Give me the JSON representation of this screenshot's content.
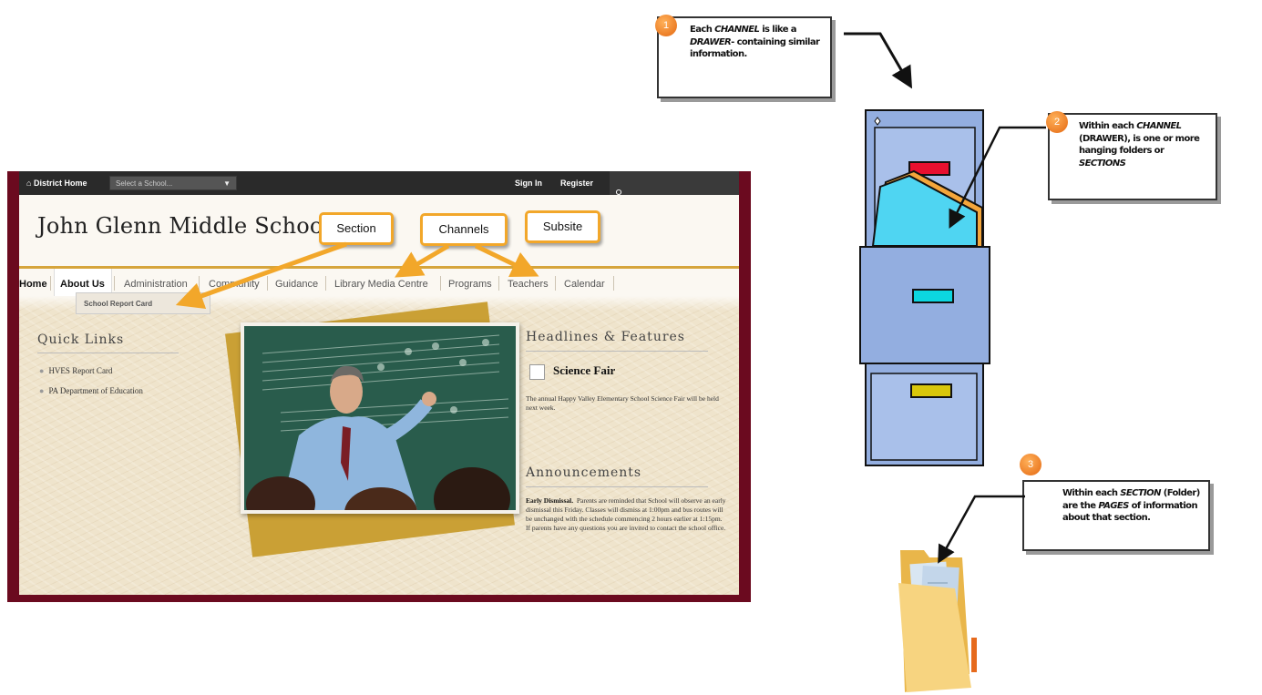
{
  "website": {
    "topbar": {
      "home": "District Home",
      "school_select": "Select a School...",
      "sign_in": "Sign In",
      "register": "Register"
    },
    "school_name": "John Glenn Middle School",
    "nav": [
      "Home",
      "About Us",
      "Administration",
      "Community",
      "Guidance",
      "Library Media Centre",
      "Programs",
      "Teachers",
      "Calendar"
    ],
    "dropdown_item": "School Report Card",
    "quick_links": {
      "title": "Quick Links",
      "items": [
        "HVES Report Card",
        "PA Department of Education"
      ]
    },
    "headlines": {
      "title": "Headlines & Features",
      "item_title": "Science Fair",
      "item_text": "The annual Happy Valley Elementary School Science Fair will be held next week."
    },
    "announcements": {
      "title": "Announcements",
      "lead": "Early Dismissal.",
      "text": "Parents are reminded that School will observe an early dismissal this Friday.  Classes will dismiss at 1:00pm and bus routes will be unchanged with the schedule commencing 2 hours earlier at 1:15pm.  If parents have any questions you are invited to contact the school office."
    }
  },
  "tags": {
    "section": "Section",
    "channels": "Channels",
    "subsite": "Subsite"
  },
  "infobox1": {
    "num": "1",
    "pre": "Each ",
    "em1": "CHANNEL",
    "mid1": " is like a ",
    "em2": "DRAWER",
    "post": "- containing similar information."
  },
  "infobox2": {
    "num": "2",
    "pre": "Within each ",
    "em1": "CHANNEL",
    "mid1": " (DRAWER), is one or more hanging folders or ",
    "em2": "SECTIONS",
    "post": ""
  },
  "infobox3": {
    "num": "3",
    "pre": "Within each ",
    "em1": "SECTION",
    "mid1": " (Folder) are the ",
    "em2": "PAGES",
    "post": " of information about that section."
  },
  "colors": {
    "tag_border": "#f2a72a",
    "site_frame": "#6b0a1f",
    "cabinet": "#93aee0",
    "folder": "#f4cd6a"
  }
}
